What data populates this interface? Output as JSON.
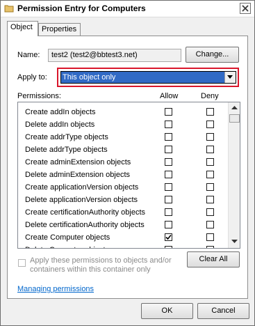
{
  "window": {
    "title": "Permission Entry for Computers"
  },
  "tabs": [
    {
      "label": "Object"
    },
    {
      "label": "Properties"
    }
  ],
  "name": {
    "label": "Name:",
    "value": "test2 (test2@bbtest3.net)",
    "change_button": "Change..."
  },
  "apply_to": {
    "label": "Apply to:",
    "selected": "This object only"
  },
  "permissions": {
    "label": "Permissions:",
    "allow_header": "Allow",
    "deny_header": "Deny",
    "rows": [
      {
        "name": "Create addIn objects",
        "allow": false,
        "deny": false
      },
      {
        "name": "Delete addIn objects",
        "allow": false,
        "deny": false
      },
      {
        "name": "Create addrType objects",
        "allow": false,
        "deny": false
      },
      {
        "name": "Delete addrType objects",
        "allow": false,
        "deny": false
      },
      {
        "name": "Create adminExtension objects",
        "allow": false,
        "deny": false
      },
      {
        "name": "Delete adminExtension objects",
        "allow": false,
        "deny": false
      },
      {
        "name": "Create applicationVersion objects",
        "allow": false,
        "deny": false
      },
      {
        "name": "Delete applicationVersion objects",
        "allow": false,
        "deny": false
      },
      {
        "name": "Create certificationAuthority objects",
        "allow": false,
        "deny": false
      },
      {
        "name": "Delete certificationAuthority objects",
        "allow": false,
        "deny": false
      },
      {
        "name": "Create Computer objects",
        "allow": true,
        "deny": false
      },
      {
        "name": "Delete Computer objects",
        "allow": false,
        "deny": false
      }
    ]
  },
  "apply_within": {
    "label": "Apply these permissions to objects and/or containers within this container only",
    "checked": false
  },
  "clear_all_button": "Clear All",
  "help_link": "Managing permissions",
  "footer": {
    "ok": "OK",
    "cancel": "Cancel"
  }
}
